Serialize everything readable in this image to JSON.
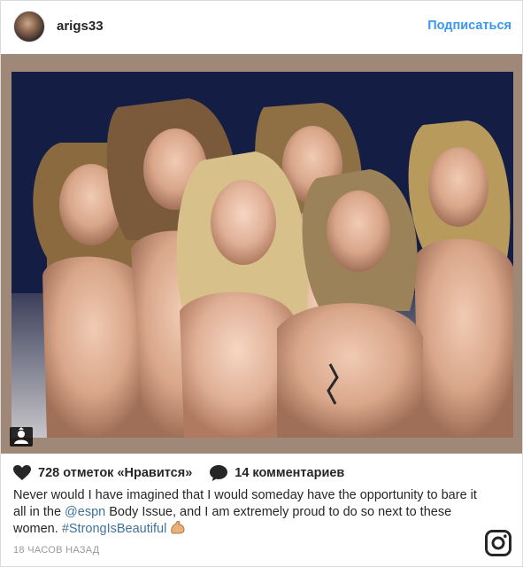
{
  "header": {
    "username": "arigs33",
    "follow_label": "Подписаться"
  },
  "photo": {
    "alt": ""
  },
  "actions": {
    "likes_text": "728 отметок «Нравится»",
    "comments_text": "14 комментариев"
  },
  "caption": {
    "part1": "Never would I have imagined that I would someday have the opportunity to bare it all in the ",
    "mention": "@espn",
    "part2": " Body Issue, and I am extremely proud to do so next to these women. ",
    "hashtag": "#StrongIsBeautiful"
  },
  "timestamp": "18 ЧАСОВ НАЗАД",
  "icons": {
    "heart": "heart-icon",
    "comment": "comment-icon",
    "instagram": "instagram-logo-icon",
    "user_tag": "user-tag-icon",
    "emoji": "flexed-biceps-emoji"
  },
  "colors": {
    "link": "#3897f0",
    "hashtag": "#3f729b",
    "text": "#262626",
    "muted": "#999999"
  }
}
